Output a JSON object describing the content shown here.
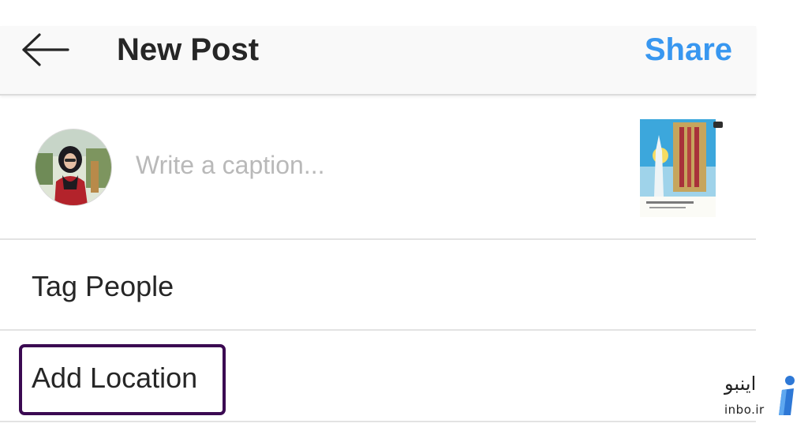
{
  "header": {
    "title": "New Post",
    "share_label": "Share",
    "back_icon": "arrow-left-icon"
  },
  "caption": {
    "placeholder": "Write a caption...",
    "value": ""
  },
  "options": {
    "tag_people": "Tag People",
    "add_location": "Add Location"
  },
  "watermark": {
    "persian": "اینبو",
    "domain": "inbo.ir"
  },
  "colors": {
    "accent": "#3897f0",
    "highlight_border": "#3b0a52",
    "header_bg": "#f9f9f9",
    "divider": "#e3e3e3"
  }
}
